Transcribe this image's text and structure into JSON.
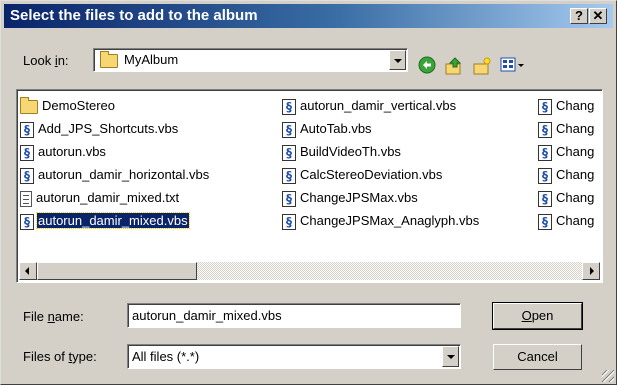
{
  "title": "Select the files to add to the album",
  "title_buttons": {
    "help": "?",
    "close": "✕"
  },
  "look_in": {
    "label_pre": "Look ",
    "label_u": "i",
    "label_post": "n:",
    "value": "MyAlbum"
  },
  "toolbar": {
    "back_icon": "back-arrow-icon",
    "up_icon": "up-folder-icon",
    "new_folder_icon": "new-folder-icon",
    "view_icon": "view-menu-icon"
  },
  "files": {
    "col1": [
      {
        "name": "DemoStereo",
        "icon": "folder"
      },
      {
        "name": "Add_JPS_Shortcuts.vbs",
        "icon": "vbs"
      },
      {
        "name": "autorun.vbs",
        "icon": "vbs"
      },
      {
        "name": "autorun_damir_horizontal.vbs",
        "icon": "vbs"
      },
      {
        "name": "autorun_damir_mixed.txt",
        "icon": "txt"
      },
      {
        "name": "autorun_damir_mixed.vbs",
        "icon": "vbs",
        "selected": true
      }
    ],
    "col2": [
      {
        "name": "autorun_damir_vertical.vbs",
        "icon": "vbs"
      },
      {
        "name": "AutoTab.vbs",
        "icon": "vbs"
      },
      {
        "name": "BuildVideoTh.vbs",
        "icon": "vbs"
      },
      {
        "name": "CalcStereoDeviation.vbs",
        "icon": "vbs"
      },
      {
        "name": "ChangeJPSMax.vbs",
        "icon": "vbs"
      },
      {
        "name": "ChangeJPSMax_Anaglyph.vbs",
        "icon": "vbs"
      }
    ],
    "col3": [
      {
        "name": "Chang",
        "icon": "vbs"
      },
      {
        "name": "Chang",
        "icon": "vbs"
      },
      {
        "name": "Chang",
        "icon": "vbs"
      },
      {
        "name": "Chang",
        "icon": "vbs"
      },
      {
        "name": "Chang",
        "icon": "vbs"
      },
      {
        "name": "Chang",
        "icon": "vbs"
      }
    ]
  },
  "file_name": {
    "label_pre": "File ",
    "label_u": "n",
    "label_post": "ame:",
    "value": "autorun_damir_mixed.vbs"
  },
  "file_type": {
    "label_pre": "Files of ",
    "label_u": "t",
    "label_post": "ype:",
    "value": "All files (*.*)"
  },
  "buttons": {
    "open_u": "O",
    "open_rest": "pen",
    "cancel": "Cancel"
  },
  "colors": {
    "title_start": "#0a246a",
    "title_end": "#a6caf0",
    "selection": "#0a246a",
    "face": "#d4d0c8"
  }
}
